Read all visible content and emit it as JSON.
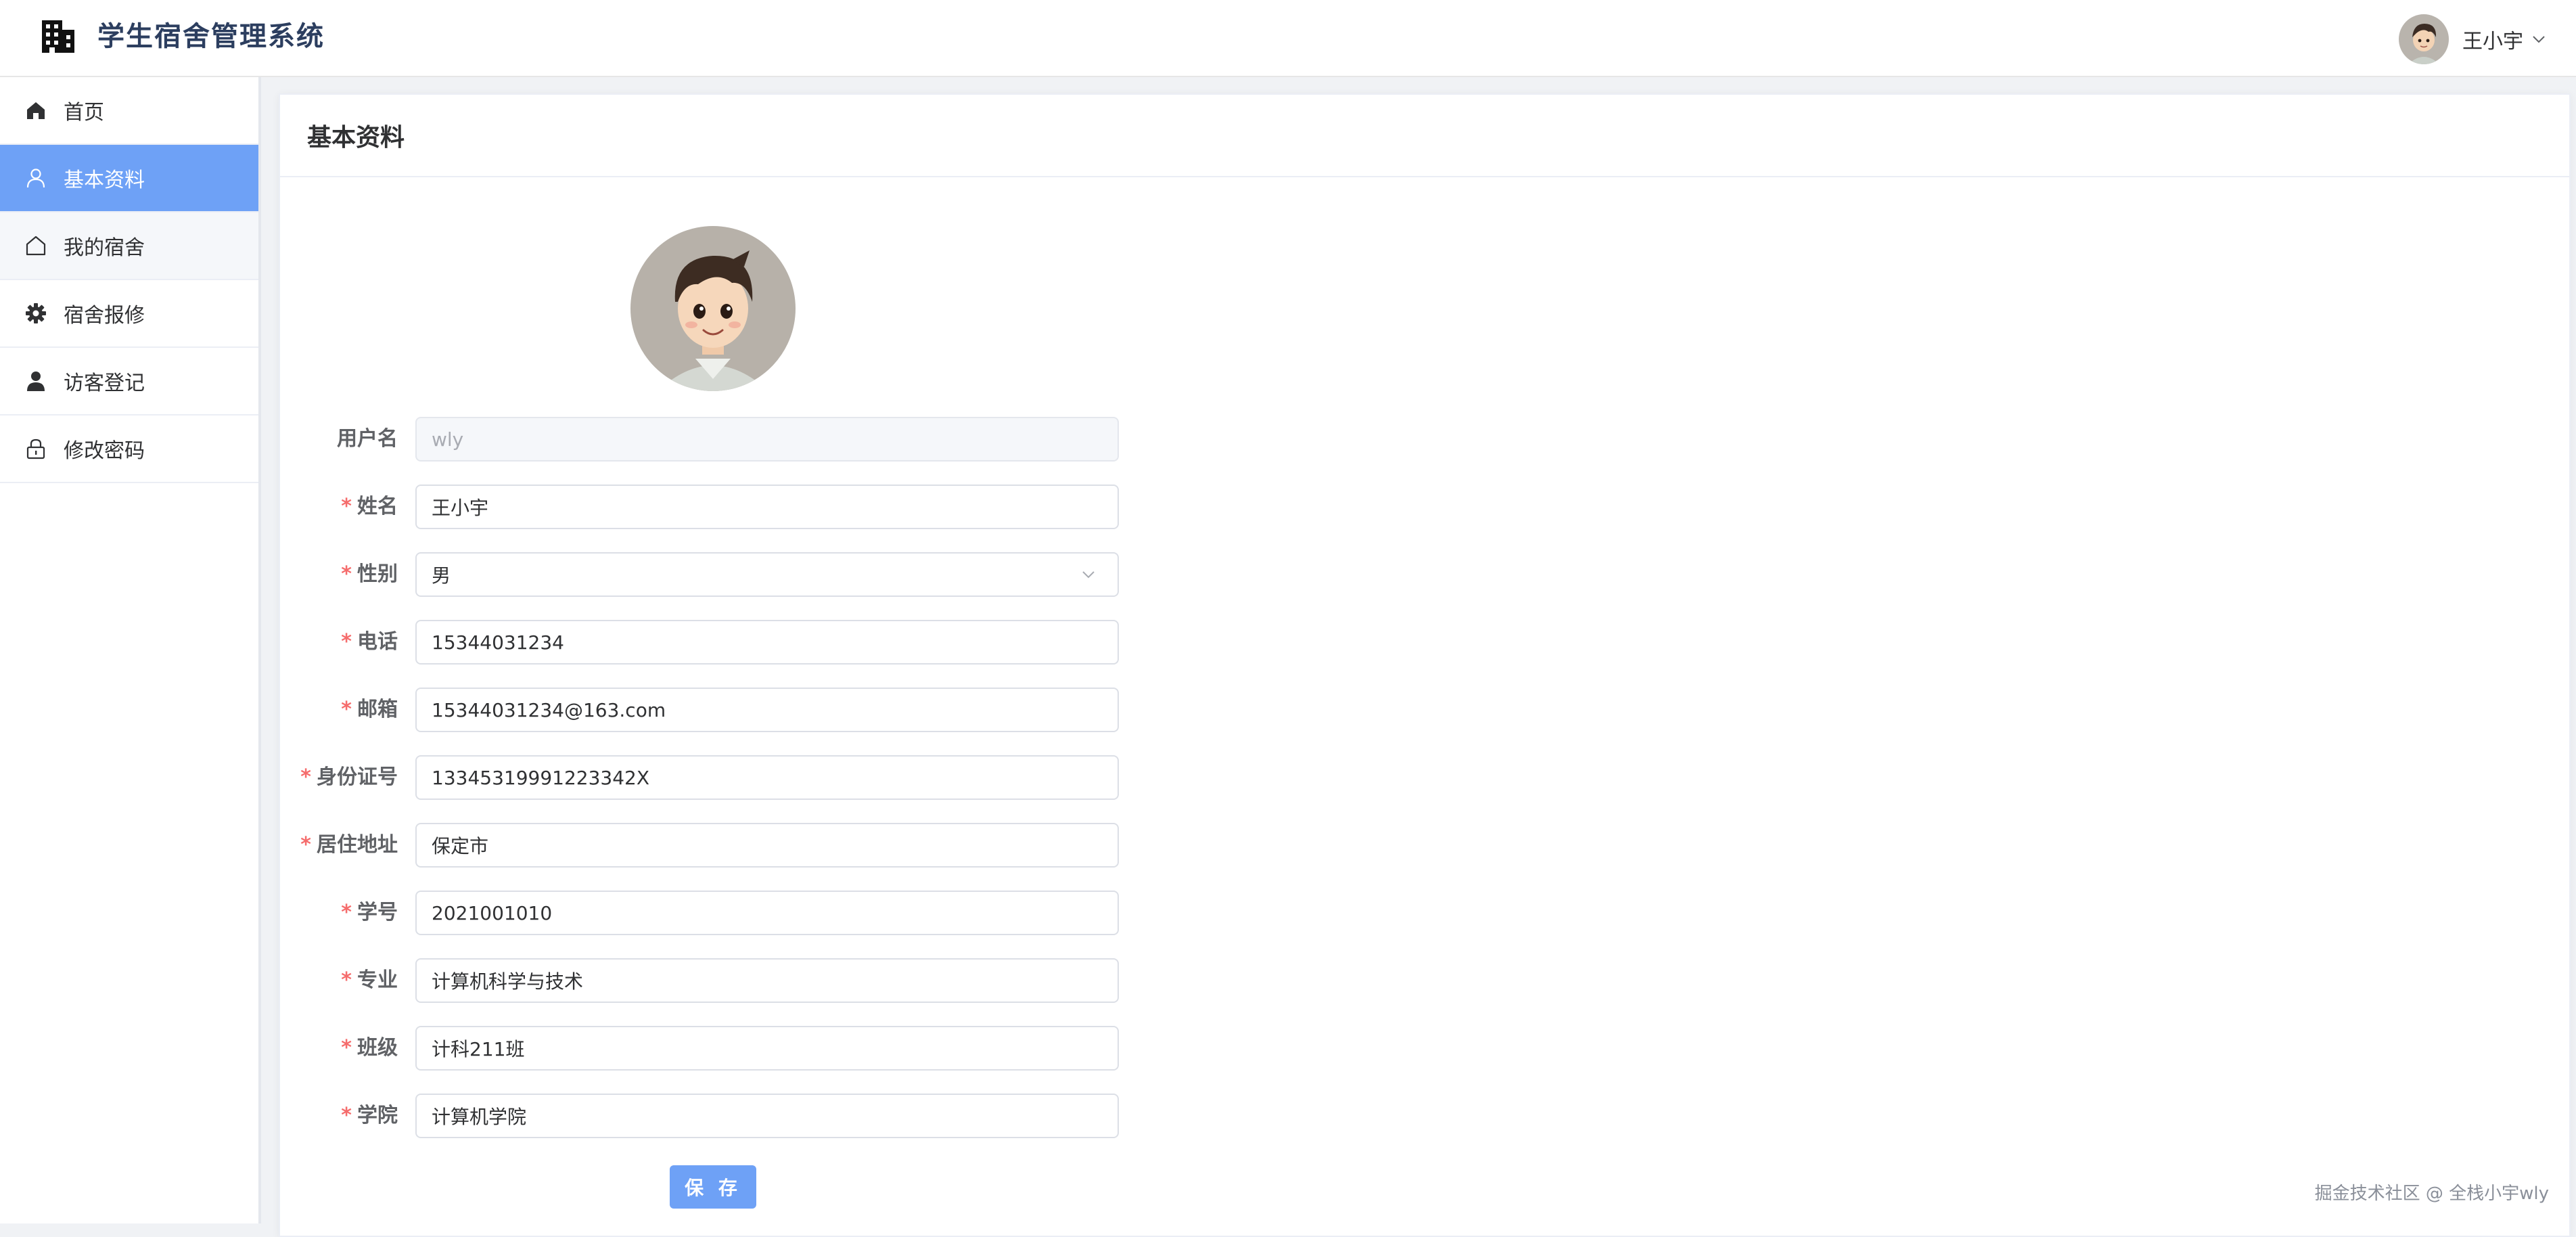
{
  "app": {
    "title": "学生宿舍管理系统",
    "user_name": "王小宇"
  },
  "sidebar": {
    "items": [
      {
        "label": "首页",
        "icon": "home-icon"
      },
      {
        "label": "基本资料",
        "icon": "user-outline-icon",
        "active": true
      },
      {
        "label": "我的宿舍",
        "icon": "house-outline-icon"
      },
      {
        "label": "宿舍报修",
        "icon": "gear-icon"
      },
      {
        "label": "访客登记",
        "icon": "user-filled-icon"
      },
      {
        "label": "修改密码",
        "icon": "lock-icon"
      }
    ]
  },
  "page": {
    "title": "基本资料"
  },
  "form": {
    "username": {
      "label": "用户名",
      "value": "wly",
      "required": false
    },
    "name": {
      "label": "姓名",
      "value": "王小宇",
      "required": true
    },
    "gender": {
      "label": "性别",
      "value": "男",
      "required": true
    },
    "phone": {
      "label": "电话",
      "value": "15344031234",
      "required": true
    },
    "email": {
      "label": "邮箱",
      "value": "15344031234@163.com",
      "required": true
    },
    "id_card": {
      "label": "身份证号",
      "value": "13345319991223342X",
      "required": true
    },
    "address": {
      "label": "居住地址",
      "value": "保定市",
      "required": true
    },
    "student_no": {
      "label": "学号",
      "value": "2021001010",
      "required": true
    },
    "major": {
      "label": "专业",
      "value": "计算机科学与技术",
      "required": true
    },
    "class_name": {
      "label": "班级",
      "value": "计科211班",
      "required": true
    },
    "college": {
      "label": "学院",
      "value": "计算机学院",
      "required": true
    },
    "required_mark": "*",
    "save_label": "保 存"
  },
  "watermark": "掘金技术社区 @ 全栈小宇wly",
  "colors": {
    "accent": "#6ea1f6",
    "required": "#f56c6c",
    "brand_text": "#2c3e5f"
  }
}
